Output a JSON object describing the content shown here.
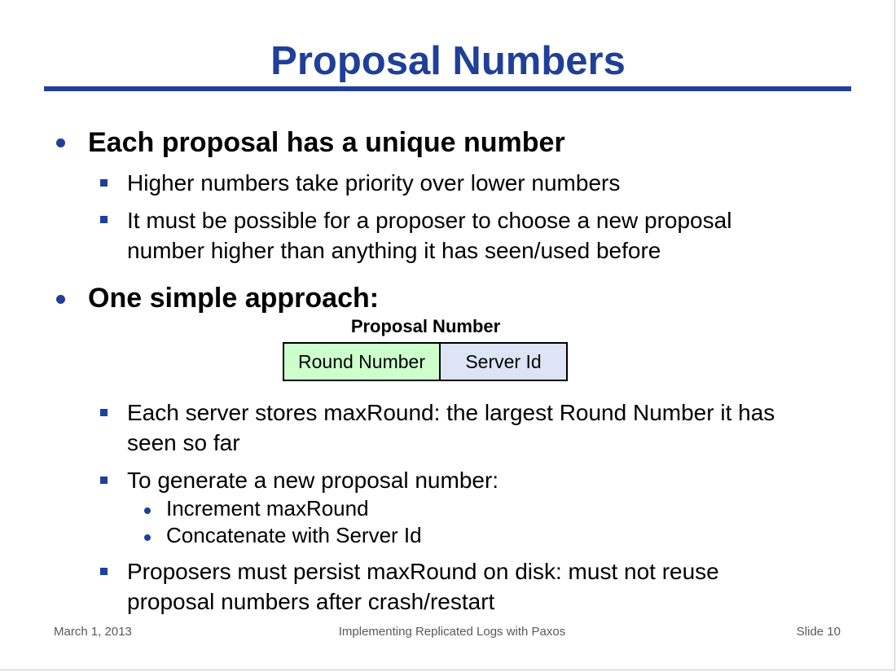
{
  "slide": {
    "title": "Proposal Numbers",
    "bullets": [
      {
        "text": "Each proposal has a unique number",
        "sub": [
          {
            "text": "Higher numbers take priority over lower numbers"
          },
          {
            "lines": [
              "It must be possible for a proposer to choose a new proposal",
              "number higher than anything it has seen/used before"
            ]
          }
        ]
      },
      {
        "text": "One simple approach:",
        "diagram": {
          "label": "Proposal Number",
          "fields": [
            "Round Number",
            "Server Id"
          ],
          "colors": {
            "round": "#ccffcc",
            "server": "#dce4f5"
          }
        },
        "sub": [
          {
            "lines": [
              "Each server stores maxRound: the largest Round Number it has",
              "seen so far"
            ]
          },
          {
            "text": "To generate a new proposal number:",
            "sub": [
              "Increment maxRound",
              "Concatenate with Server Id"
            ]
          },
          {
            "lines": [
              "Proposers must persist maxRound on disk: must not reuse",
              "proposal numbers after crash/restart"
            ]
          }
        ]
      }
    ],
    "footer": {
      "date": "March 1, 2013",
      "center": "Implementing Replicated Logs with Paxos",
      "slide_number": "Slide 10"
    },
    "accent_color": "#1f3f99"
  }
}
